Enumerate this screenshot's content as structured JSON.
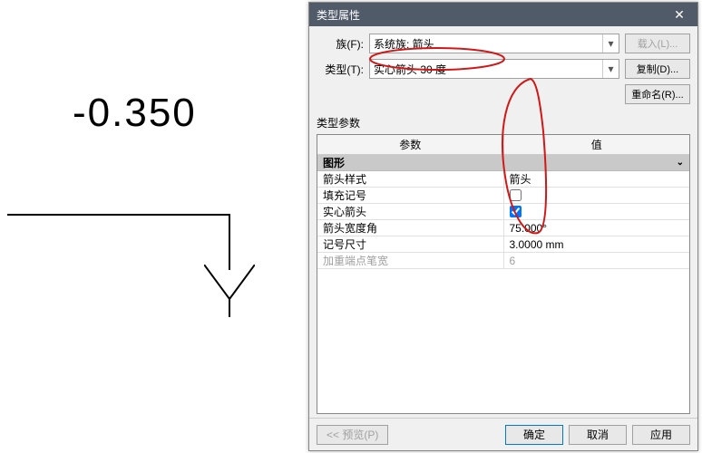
{
  "drawing": {
    "value_text": "-0.350"
  },
  "dialog": {
    "title": "类型属性",
    "family_label": "族(F):",
    "family_value": "系统族: 箭头",
    "type_label": "类型(T):",
    "type_value": "实心箭头 30 度",
    "load_btn": "载入(L)...",
    "duplicate_btn": "复制(D)...",
    "rename_btn": "重命名(R)...",
    "section_label": "类型参数",
    "table": {
      "head_param": "参数",
      "head_value": "值",
      "group_graphics": "图形",
      "rows": [
        {
          "label": "箭头样式",
          "value": "箭头",
          "kind": "text"
        },
        {
          "label": "填充记号",
          "value": false,
          "kind": "check"
        },
        {
          "label": "实心箭头",
          "value": true,
          "kind": "check"
        },
        {
          "label": "箭头宽度角",
          "value": "75.000°",
          "kind": "text"
        },
        {
          "label": "记号尺寸",
          "value": "3.0000 mm",
          "kind": "text"
        },
        {
          "label": "加重端点笔宽",
          "value": "6",
          "kind": "text",
          "disabled": true
        }
      ]
    },
    "footer": {
      "preview_btn": "<< 预览(P)",
      "ok_btn": "确定",
      "cancel_btn": "取消",
      "apply_btn": "应用"
    }
  }
}
